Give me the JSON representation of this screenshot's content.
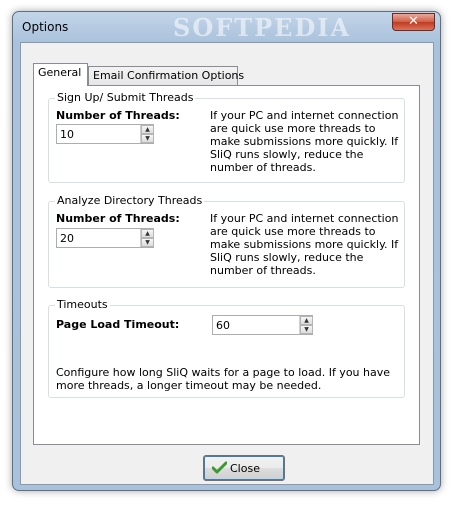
{
  "window": {
    "title": "Options",
    "watermark": "SOFTPEDIA",
    "close_glyph": "✕"
  },
  "tabs": [
    {
      "label": "General",
      "active": true
    },
    {
      "label": "Email Confirmation Options",
      "active": false
    }
  ],
  "signup": {
    "title": "Sign Up/ Submit Threads",
    "label": "Number of Threads:",
    "value": "10",
    "description": "If your PC and internet connection are quick use more threads to make submissions more quickly. If SliQ runs slowly, reduce the number of threads."
  },
  "analyze": {
    "title": "Analyze Directory Threads",
    "label": "Number of Threads:",
    "value": "20",
    "description": "If your PC and internet connection are quick use more threads to make submissions more quickly. If SliQ runs slowly, reduce the number of threads."
  },
  "timeouts": {
    "title": "Timeouts",
    "label": "Page Load Timeout:",
    "value": "60",
    "description": "Configure how long SliQ waits for a page to load. If you have more threads, a longer timeout may be needed."
  },
  "footer": {
    "close_label": "Close"
  },
  "colors": {
    "check_green": "#3a9a2c"
  }
}
